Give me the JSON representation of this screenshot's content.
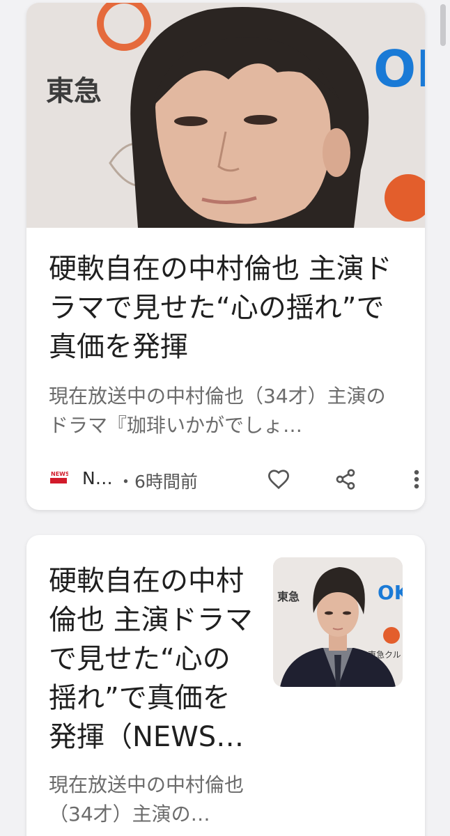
{
  "articles": [
    {
      "title": "硬軟自在の中村倫也 主演ドラマで見せた“心の揺れ”で真価を発揮",
      "snippet": "現在放送中の中村倫也（34才）主演のドラマ『珈琲いかがでしょ…",
      "source": "N…",
      "source_logo_text": "NEWSポスト",
      "time": "・6時間前",
      "actions": {
        "like_icon": "heart-icon",
        "share_icon": "share-icon",
        "more_icon": "more-vert-icon"
      },
      "image_background_text": [
        "東急",
        "OK"
      ]
    },
    {
      "title": "硬軟自在の中村倫也 主演ドラマで見せた“心の揺れ”で真価を発揮（NEWS…",
      "snippet": "現在放送中の中村倫也（34才）主演の…",
      "image_background_text": [
        "東急",
        "OK",
        "東急クル"
      ]
    }
  ],
  "colors": {
    "background": "#f2f2f4",
    "card": "#ffffff",
    "title": "#1f1f1f",
    "snippet": "#6b6b6b",
    "icon": "#555555"
  }
}
